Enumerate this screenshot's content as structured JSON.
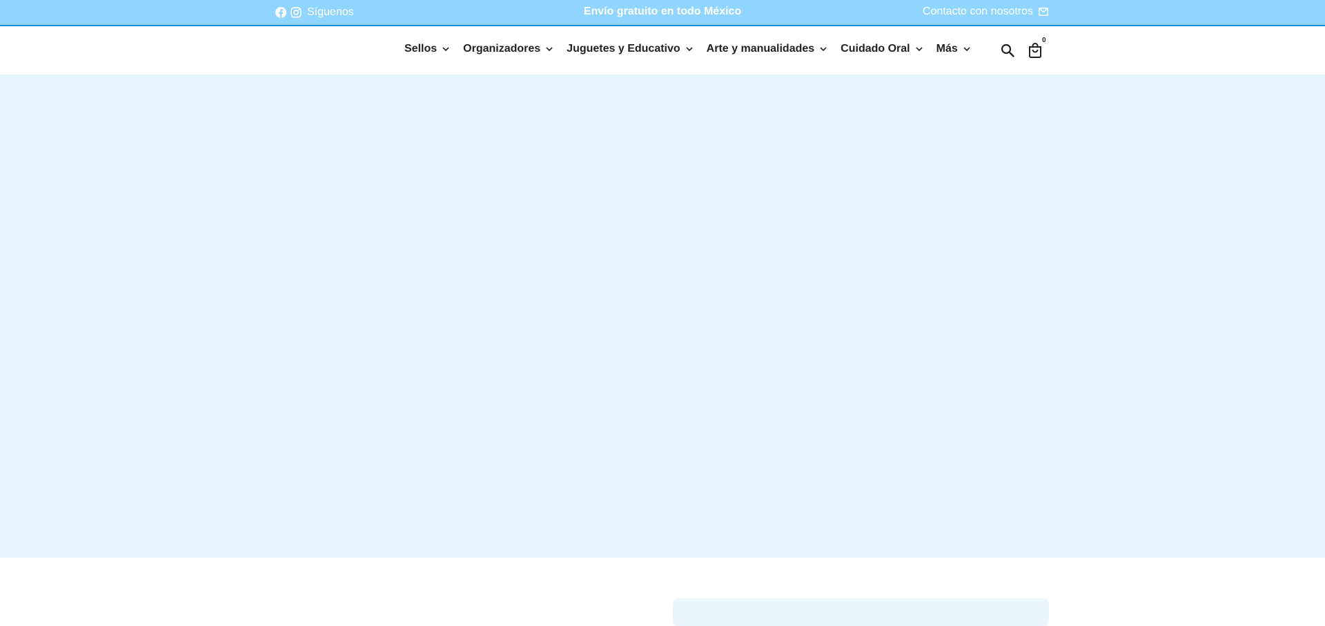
{
  "announcement": {
    "follow_label": "Síguenos",
    "shipping_text": "Envío gratuito en todo México",
    "contact_label": "Contacto con nosotros"
  },
  "icons": {
    "facebook": "facebook-icon",
    "instagram": "instagram-icon",
    "mail": "mail-icon",
    "search": "search-icon",
    "cart": "shopping-bag-icon",
    "chevron": "chevron-down-icon"
  },
  "nav": {
    "items": [
      {
        "label": "Sellos"
      },
      {
        "label": "Organizadores"
      },
      {
        "label": "Juguetes y Educativo"
      },
      {
        "label": "Arte y manualidades"
      },
      {
        "label": "Cuidado Oral"
      },
      {
        "label": "Más"
      }
    ]
  },
  "cart": {
    "count": "0"
  },
  "colors": {
    "announcement_bg": "#8fd5fd",
    "announcement_border": "#1a8fd6",
    "hero_bg": "#e6f4fd",
    "nav_text": "#222222"
  }
}
